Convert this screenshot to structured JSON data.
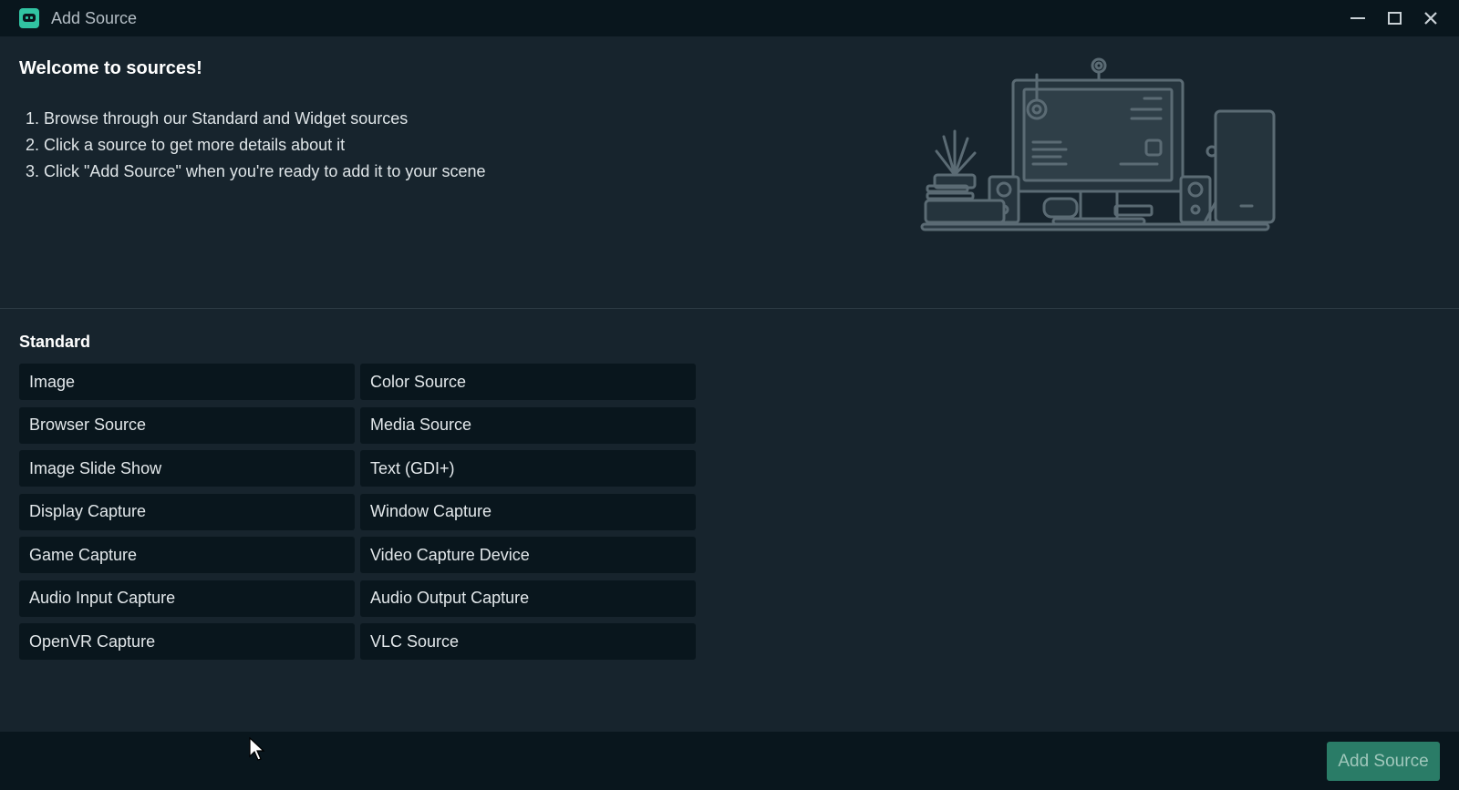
{
  "window": {
    "title": "Add Source",
    "icon": "streamlabs-robot-icon",
    "accent": "#31c3a2"
  },
  "welcome": {
    "title": "Welcome to sources!",
    "steps": [
      "1. Browse through our Standard and Widget sources",
      "2. Click a source to get more details about it",
      "3. Click \"Add Source\" when you're ready to add it to your scene"
    ]
  },
  "standard": {
    "title": "Standard",
    "items": [
      "Image",
      "Color Source",
      "Browser Source",
      "Media Source",
      "Image Slide Show",
      "Text (GDI+)",
      "Display Capture",
      "Window Capture",
      "Game Capture",
      "Video Capture Device",
      "Audio Input Capture",
      "Audio Output Capture",
      "OpenVR Capture",
      "VLC Source"
    ]
  },
  "footer": {
    "add_source_label": "Add Source",
    "button_color": "#2a7c67"
  }
}
